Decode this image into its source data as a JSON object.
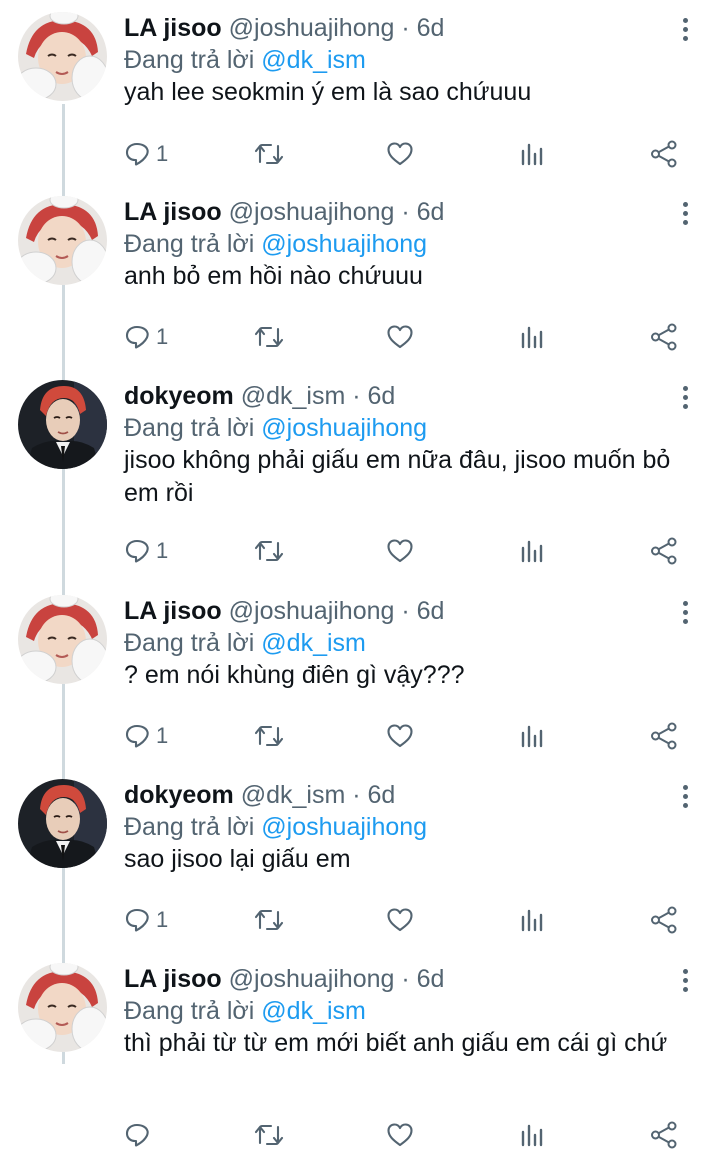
{
  "tweets": [
    {
      "name": "LA jisoo",
      "handle": "@joshuajihong",
      "separator": "·",
      "time": "6d",
      "reply_prefix": "Đang trả lời",
      "reply_to": "@dk_ism",
      "text": "yah lee seokmin ý em là sao chứuuu",
      "reply_count": "1",
      "avatar": "avatar-jisoo"
    },
    {
      "name": "LA jisoo",
      "handle": "@joshuajihong",
      "separator": "·",
      "time": "6d",
      "reply_prefix": "Đang trả lời",
      "reply_to": "@joshuajihong",
      "text": "anh bỏ em hồi nào chứuuu",
      "reply_count": "1",
      "avatar": "avatar-jisoo"
    },
    {
      "name": "dokyeom",
      "handle": "@dk_ism",
      "separator": "·",
      "time": "6d",
      "reply_prefix": "Đang trả lời",
      "reply_to": "@joshuajihong",
      "text": "jisoo không phải giấu em nữa đâu, jisoo muốn bỏ em rồi",
      "reply_count": "1",
      "avatar": "avatar-dokyeom"
    },
    {
      "name": "LA jisoo",
      "handle": "@joshuajihong",
      "separator": "·",
      "time": "6d",
      "reply_prefix": "Đang trả lời",
      "reply_to": "@dk_ism",
      "text": "? em nói khùng điên gì vậy???",
      "reply_count": "1",
      "avatar": "avatar-jisoo"
    },
    {
      "name": "dokyeom",
      "handle": "@dk_ism",
      "separator": "·",
      "time": "6d",
      "reply_prefix": "Đang trả lời",
      "reply_to": "@joshuajihong",
      "text": "sao jisoo lại giấu em",
      "reply_count": "1",
      "avatar": "avatar-dokyeom"
    },
    {
      "name": "LA jisoo",
      "handle": "@joshuajihong",
      "separator": "·",
      "time": "6d",
      "reply_prefix": "Đang trả lời",
      "reply_to": "@dk_ism",
      "text": "thì phải từ từ em mới biết anh giấu em cái gì chứ",
      "reply_count": "",
      "avatar": "avatar-jisoo"
    }
  ],
  "colors": {
    "link": "#1d9bf0",
    "secondary_text": "#536471",
    "thread_line": "#cfd9de"
  }
}
